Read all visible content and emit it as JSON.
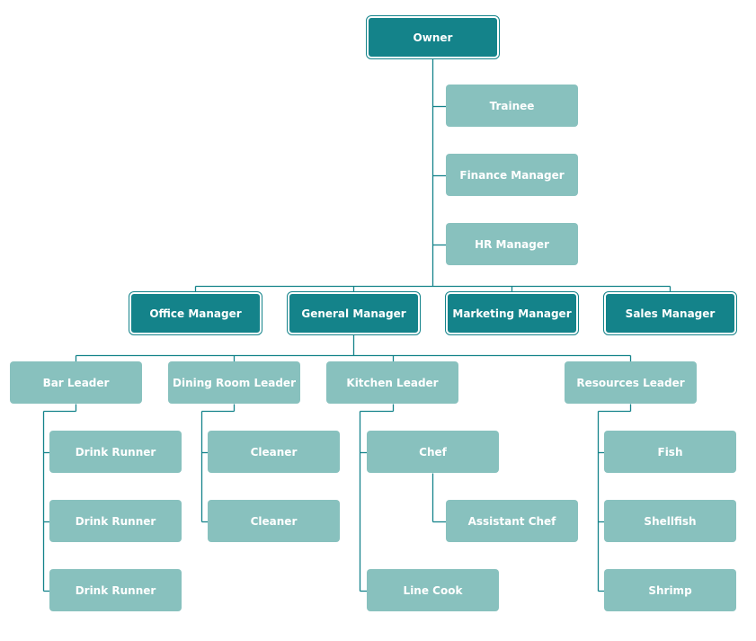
{
  "colors": {
    "dark": "#14838a",
    "light": "#88c1be",
    "line": "#14838a"
  },
  "nodes": {
    "owner": {
      "label": "Owner",
      "style": "dark"
    },
    "trainee": {
      "label": "Trainee",
      "style": "light",
      "parent": "owner"
    },
    "finance": {
      "label": "Finance Manager",
      "style": "light",
      "parent": "owner"
    },
    "hr": {
      "label": "HR Manager",
      "style": "light",
      "parent": "owner"
    },
    "office": {
      "label": "Office Manager",
      "style": "dark",
      "parent": "owner"
    },
    "general": {
      "label": "General Manager",
      "style": "dark",
      "parent": "owner"
    },
    "marketing": {
      "label": "Marketing Manager",
      "style": "dark",
      "parent": "owner"
    },
    "sales": {
      "label": "Sales Manager",
      "style": "dark",
      "parent": "owner"
    },
    "bar": {
      "label": "Bar Leader",
      "style": "light",
      "parent": "general"
    },
    "dining": {
      "label": "Dining Room Leader",
      "style": "light",
      "parent": "general"
    },
    "kitchen": {
      "label": "Kitchen Leader",
      "style": "light",
      "parent": "general"
    },
    "resources": {
      "label": "Resources Leader",
      "style": "light",
      "parent": "general"
    },
    "runner1": {
      "label": "Drink Runner",
      "style": "light",
      "parent": "bar"
    },
    "runner2": {
      "label": "Drink Runner",
      "style": "light",
      "parent": "bar"
    },
    "runner3": {
      "label": "Drink Runner",
      "style": "light",
      "parent": "bar"
    },
    "cleaner1": {
      "label": "Cleaner",
      "style": "light",
      "parent": "dining"
    },
    "cleaner2": {
      "label": "Cleaner",
      "style": "light",
      "parent": "dining"
    },
    "chef": {
      "label": "Chef",
      "style": "light",
      "parent": "kitchen"
    },
    "asstchef": {
      "label": "Assistant Chef",
      "style": "light",
      "parent": "chef"
    },
    "linecook": {
      "label": "Line Cook",
      "style": "light",
      "parent": "kitchen"
    },
    "fish": {
      "label": "Fish",
      "style": "light",
      "parent": "resources"
    },
    "shellfish": {
      "label": "Shellfish",
      "style": "light",
      "parent": "resources"
    },
    "shrimp": {
      "label": "Shrimp",
      "style": "light",
      "parent": "resources"
    }
  }
}
